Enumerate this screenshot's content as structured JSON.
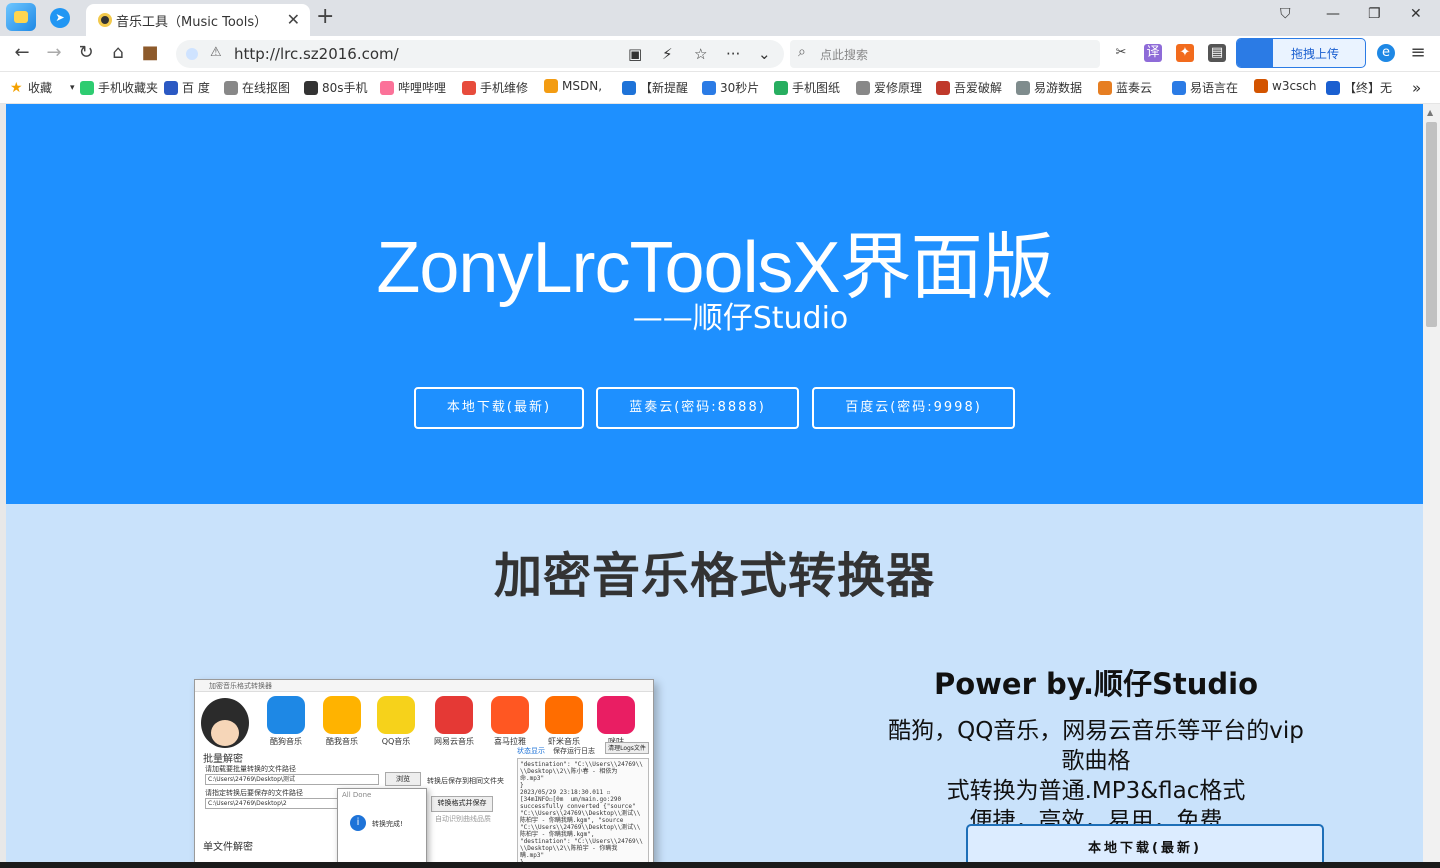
{
  "browser": {
    "tab_title": "音乐工具（Music Tools）",
    "url": "http://lrc.sz2016.com/",
    "search_placeholder": "点此搜索",
    "upload_label": "拖拽上传",
    "translate_label": "译"
  },
  "bookmarks": [
    {
      "label": "收藏",
      "color": "#f4a100"
    },
    {
      "label": "手机收藏夹",
      "color": "#2ecc71"
    },
    {
      "label": "百 度",
      "color": "#2b59c3"
    },
    {
      "label": "在线抠图",
      "color": "#888888"
    },
    {
      "label": "80s手机",
      "color": "#333333"
    },
    {
      "label": "哔哩哔哩",
      "color": "#fb7299"
    },
    {
      "label": "手机维修",
      "color": "#e74c3c"
    },
    {
      "label": "MSDN,",
      "color": "#f39c12"
    },
    {
      "label": "【新提醒",
      "color": "#1e73d8"
    },
    {
      "label": "30秒片",
      "color": "#2b7be5"
    },
    {
      "label": "手机图纸",
      "color": "#27ae60"
    },
    {
      "label": "爱修原理",
      "color": "#888888"
    },
    {
      "label": "吾爱破解",
      "color": "#c0392b"
    },
    {
      "label": "易游数据",
      "color": "#7f8c8d"
    },
    {
      "label": "蓝奏云",
      "color": "#e67e22"
    },
    {
      "label": "易语言在",
      "color": "#2b7be5"
    },
    {
      "label": "w3csch",
      "color": "#d35400"
    },
    {
      "label": "【终】无",
      "color": "#1a5fd0"
    }
  ],
  "hero": {
    "title": "ZonyLrcToolsX界面版",
    "subtitle": "——顺仔Studio",
    "buttons": [
      "本地下载(最新)",
      "蓝奏云(密码:8888)",
      "百度云(密码:9998)"
    ]
  },
  "section": {
    "heading": "加密音乐格式转换器",
    "power": "Power by.顺仔Studio",
    "desc_lines": [
      "酷狗，QQ音乐，网易云音乐等平台的vip歌曲格",
      "式转换为普通.MP3&flac格式",
      "便捷，高效，易用，免费"
    ],
    "download_button": "本地下载(最新)"
  },
  "screenshot": {
    "window_title": "加密音乐格式转换器",
    "apps": [
      {
        "label": "酷狗音乐",
        "color": "#1e88e5"
      },
      {
        "label": "酷我音乐",
        "color": "#ffb300"
      },
      {
        "label": "QQ音乐",
        "color": "#f6d21b"
      },
      {
        "label": "网易云音乐",
        "color": "#e53935"
      },
      {
        "label": "喜马拉雅",
        "color": "#ff5722"
      },
      {
        "label": "虾米音乐",
        "color": "#ff6d00"
      },
      {
        "label": "咪咕",
        "color": "#e91e63"
      }
    ],
    "batch_label": "批量解密",
    "path_label_1": "请加载要批量转换的文件路径",
    "path_value_1": "C:\\Users\\24769\\Desktop\\测试",
    "path_label_2": "请指定转换后要保存的文件路径",
    "path_value_2": "C:\\Users\\24769\\Desktop\\2",
    "browse": "浏览",
    "convert": "转换格式并保存",
    "opt1": "转换后保存到相同文件夹",
    "opt2": "自动识别曲线品质",
    "status_label": "状态显示",
    "opt3": "保存运行日志",
    "clear_logs": "清理Logs文件",
    "single_label": "单文件解密",
    "dialog_title": "All Done",
    "dialog_msg": "转换完成!",
    "log_text": "\"destination\": \"C:\\\\Users\\\\24769\\\\\n\\\\Desktop\\\\2\\\\陈小春 - 相依为\n命.mp3\"\n}\n2023/05/29 23:18:30.011 ☐\n[34mINFO☐[0m  um/main.go:290\nsuccessfully converted {\"source\"\n\"C:\\\\Users\\\\24769\\\\Desktop\\\\测试\\\\\n陈柏宇 - 你瞒我瞒.kgm\", \"source\n\"C:\\\\Users\\\\24769\\\\Desktop\\\\测试\\\\\n陈柏宇 - 你瞒我瞒.kgm\",\n\"destination\": \"C:\\\\Users\\\\24769\\\\\n\\\\Desktop\\\\2\\\\陈柏宇 - 你瞒我\n瞒.mp3\"\n}"
  }
}
